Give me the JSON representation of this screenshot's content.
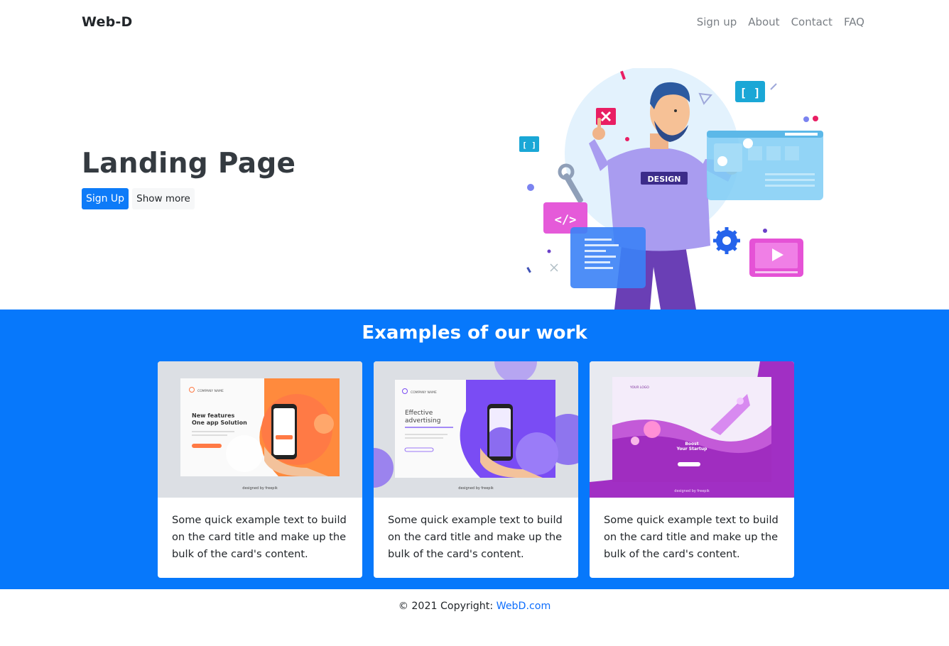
{
  "navbar": {
    "brand": "Web-D",
    "links": [
      "Sign up",
      "About",
      "Contact",
      "FAQ"
    ]
  },
  "hero": {
    "title": "Landing Page",
    "primary_button": "Sign Up",
    "secondary_button": "Show more",
    "illustration": {
      "shirt_label": "DESIGN",
      "code_tag": "</>",
      "bracket_label": "[ ]"
    }
  },
  "work": {
    "title": "Examples of our work",
    "cards": [
      {
        "text": "Some quick example text to build on the card title and make up the bulk of the card's content.",
        "mock_brand": "COMPANY NAME",
        "mock_headline_1": "New features",
        "mock_headline_2": "One app Solution",
        "credit": "designed by freepik"
      },
      {
        "text": "Some quick example text to build on the card title and make up the bulk of the card's content.",
        "mock_brand": "COMPANY NAME",
        "mock_headline_1": "Effective",
        "mock_headline_2": "advertising",
        "credit": "designed by freepik"
      },
      {
        "text": "Some quick example text to build on the card title and make up the bulk of the card's content.",
        "mock_brand": "YOUR LOGO",
        "mock_headline_1": "Boost",
        "mock_headline_2": "Your Startup",
        "credit": "designed by freepik"
      }
    ]
  },
  "footer": {
    "prefix": "© 2021 Copyright: ",
    "link": "WebD.com"
  },
  "colors": {
    "primary": "#0778fb",
    "footer_link": "#0d6efd",
    "nav_link": "#7a7f85"
  }
}
